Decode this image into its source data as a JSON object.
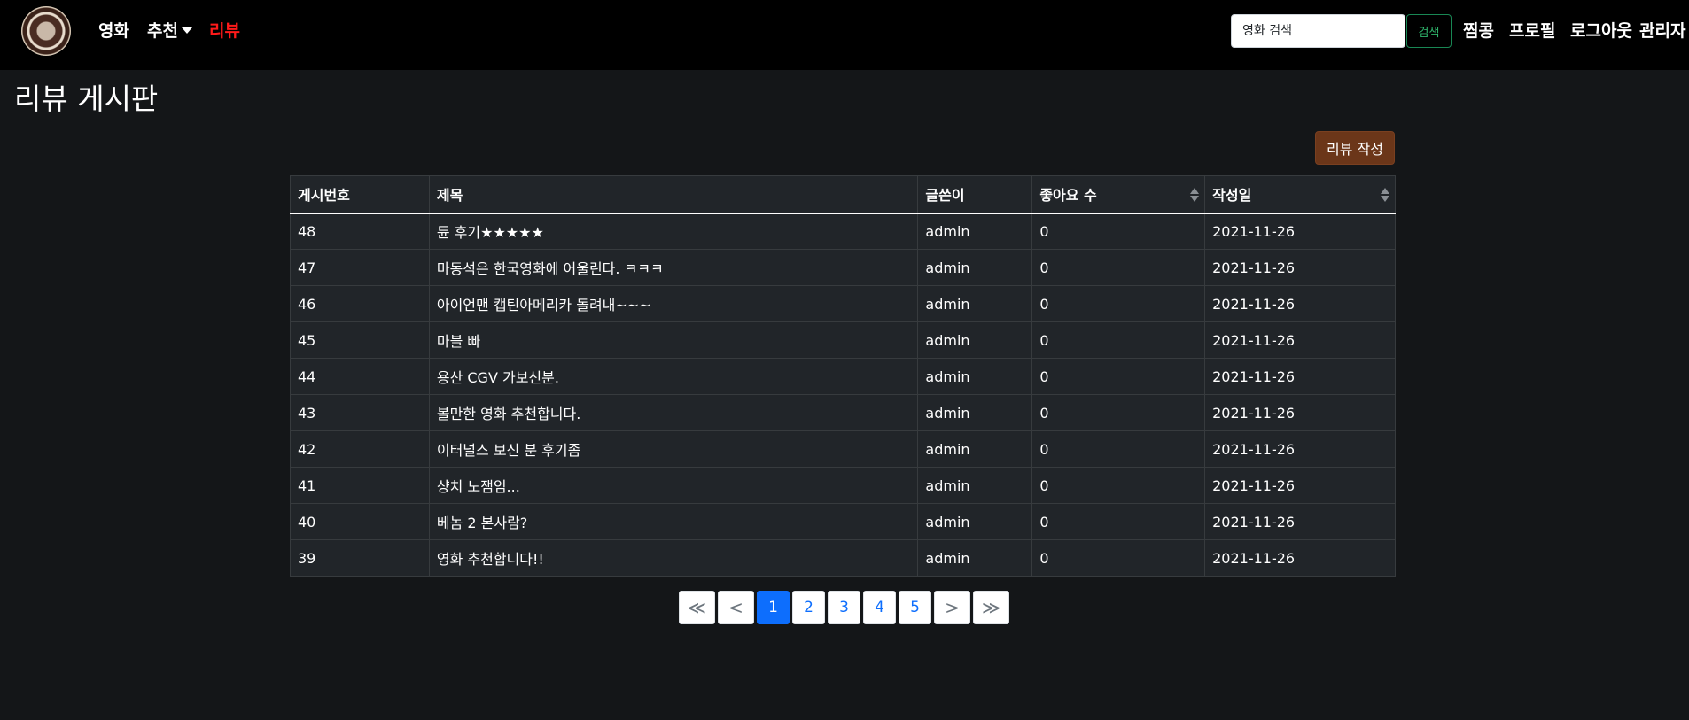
{
  "navbar": {
    "links": [
      {
        "label": "영화"
      },
      {
        "label": "추천"
      },
      {
        "label": "리뷰"
      }
    ],
    "search_placeholder": "영화 검색",
    "search_button": "검색",
    "right_links": [
      {
        "label": "찜콩"
      },
      {
        "label": "프로필"
      },
      {
        "label": "로그아웃"
      },
      {
        "label": "관리자"
      }
    ]
  },
  "page_title": "리뷰 게시판",
  "write_button": "리뷰 작성",
  "table": {
    "headers": [
      "게시번호",
      "제목",
      "글쓴이",
      "좋아요 수",
      "작성일"
    ],
    "rows": [
      {
        "id": "48",
        "title": "듄 후기★★★★★",
        "author": "admin",
        "likes": "0",
        "date": "2021-11-26"
      },
      {
        "id": "47",
        "title": "마동석은 한국영화에 어울린다. ㅋㅋㅋ",
        "author": "admin",
        "likes": "0",
        "date": "2021-11-26"
      },
      {
        "id": "46",
        "title": "아이언맨 캡틴아메리카 돌려내~~~",
        "author": "admin",
        "likes": "0",
        "date": "2021-11-26"
      },
      {
        "id": "45",
        "title": "마블 빠",
        "author": "admin",
        "likes": "0",
        "date": "2021-11-26"
      },
      {
        "id": "44",
        "title": "용산 CGV 가보신분.",
        "author": "admin",
        "likes": "0",
        "date": "2021-11-26"
      },
      {
        "id": "43",
        "title": "볼만한 영화 추천합니다.",
        "author": "admin",
        "likes": "0",
        "date": "2021-11-26"
      },
      {
        "id": "42",
        "title": "이터널스 보신 분 후기좀",
        "author": "admin",
        "likes": "0",
        "date": "2021-11-26"
      },
      {
        "id": "41",
        "title": "샹치 노잼임...",
        "author": "admin",
        "likes": "0",
        "date": "2021-11-26"
      },
      {
        "id": "40",
        "title": "베놈 2 본사람?",
        "author": "admin",
        "likes": "0",
        "date": "2021-11-26"
      },
      {
        "id": "39",
        "title": "영화 추천합니다!!",
        "author": "admin",
        "likes": "0",
        "date": "2021-11-26"
      }
    ]
  },
  "pagination": {
    "first": "≪",
    "prev": "<",
    "pages": [
      "1",
      "2",
      "3",
      "4",
      "5"
    ],
    "active_page": "1",
    "next": ">",
    "last": "≫"
  },
  "colors": {
    "background": "#141618",
    "navbar": "#000000",
    "active_nav": "#ff1a1a",
    "write_button": "#6b3619",
    "search_button_border": "#198754",
    "pagination_active": "#0d6efd"
  }
}
